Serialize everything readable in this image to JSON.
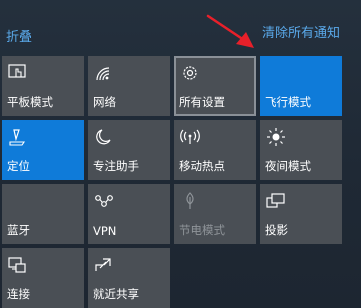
{
  "header": {
    "collapse_label": "折叠",
    "clear_all_label": "清除所有通知"
  },
  "colors": {
    "tile_off": "#4a4f55",
    "tile_on": "#0f7bd9",
    "link": "#5aa9ea",
    "arrow": "#e8202a"
  },
  "tiles": [
    {
      "label": "平板模式",
      "icon": "tablet-mode-icon",
      "active": false
    },
    {
      "label": "网络",
      "icon": "network-icon",
      "active": false
    },
    {
      "label": "所有设置",
      "icon": "gear-icon",
      "active": false
    },
    {
      "label": "飞行模式",
      "icon": "airplane-mode-icon",
      "active": true
    },
    {
      "label": "定位",
      "icon": "location-icon",
      "active": true
    },
    {
      "label": "专注助手",
      "icon": "moon-icon",
      "active": false
    },
    {
      "label": "移动热点",
      "icon": "hotspot-icon",
      "active": false
    },
    {
      "label": "夜间模式",
      "icon": "brightness-icon",
      "active": false
    },
    {
      "label": "蓝牙",
      "icon": "bluetooth-icon",
      "active": false
    },
    {
      "label": "VPN",
      "icon": "vpn-icon",
      "active": false
    },
    {
      "label": "节电模式",
      "icon": "battery-saver-icon",
      "active": false,
      "disabled": true
    },
    {
      "label": "投影",
      "icon": "project-icon",
      "active": false
    },
    {
      "label": "连接",
      "icon": "connect-icon",
      "active": false
    },
    {
      "label": "就近共享",
      "icon": "nearby-share-icon",
      "active": false
    }
  ]
}
